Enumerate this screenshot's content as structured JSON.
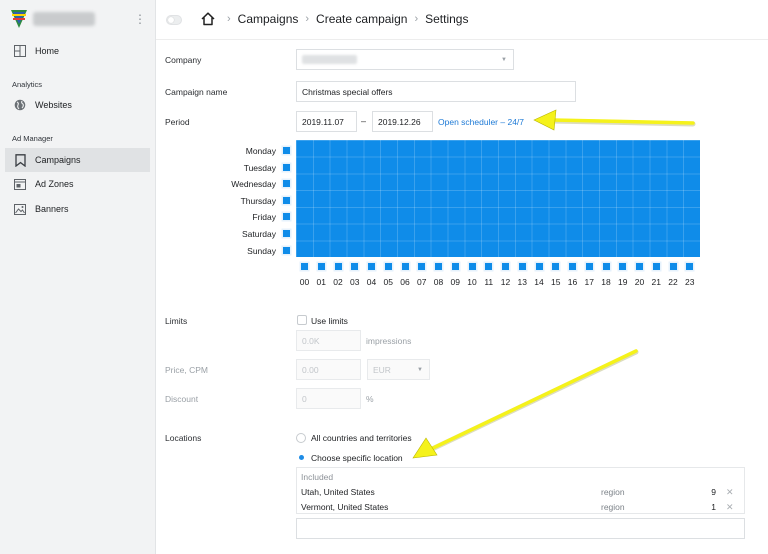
{
  "sidebar": {
    "items": [
      {
        "label": "Home",
        "icon": "home-grid-icon"
      },
      {
        "label": "Websites",
        "icon": "globe-icon"
      },
      {
        "label": "Campaigns",
        "icon": "bookmark-icon"
      },
      {
        "label": "Ad Zones",
        "icon": "ad-zones-icon"
      },
      {
        "label": "Banners",
        "icon": "image-icon"
      }
    ],
    "sections": {
      "analytics": "Analytics",
      "ad_manager": "Ad Manager"
    }
  },
  "header": {
    "breadcrumbs": [
      "Campaigns",
      "Create campaign",
      "Settings"
    ]
  },
  "form": {
    "company_label": "Company",
    "campaign_name_label": "Campaign name",
    "campaign_name_value": "Christmas special offers",
    "period_label": "Period",
    "period_start": "2019.11.07",
    "period_sep": "–",
    "period_end": "2019.12.26",
    "scheduler_link": "Open scheduler – 24/7",
    "limits_label": "Limits",
    "use_limits_label": "Use limits",
    "impressions_placeholder": "0.0K",
    "impressions_unit": "impressions",
    "price_label": "Price, CPM",
    "price_placeholder": "0.00",
    "currency": "EUR",
    "discount_label": "Discount",
    "discount_placeholder": "0",
    "discount_unit": "%",
    "locations_label": "Locations",
    "all_countries_label": "All countries and territories",
    "specific_location_label": "Choose specific location",
    "included_label": "Included",
    "locations": [
      {
        "name": "Utah, United States",
        "type": "region",
        "count": "9"
      },
      {
        "name": "Vermont, United States",
        "type": "region",
        "count": "1"
      }
    ]
  },
  "scheduler": {
    "days": [
      "Monday",
      "Tuesday",
      "Wednesday",
      "Thursday",
      "Friday",
      "Saturday",
      "Sunday"
    ],
    "hours": [
      "00",
      "01",
      "02",
      "03",
      "04",
      "05",
      "06",
      "07",
      "08",
      "09",
      "10",
      "11",
      "12",
      "13",
      "14",
      "15",
      "16",
      "17",
      "18",
      "19",
      "20",
      "21",
      "22",
      "23"
    ],
    "selected_fraction": 1.0
  },
  "colors": {
    "accent": "#0f8ce9",
    "link": "#1e7ad6",
    "arrow": "#f5f21a"
  }
}
